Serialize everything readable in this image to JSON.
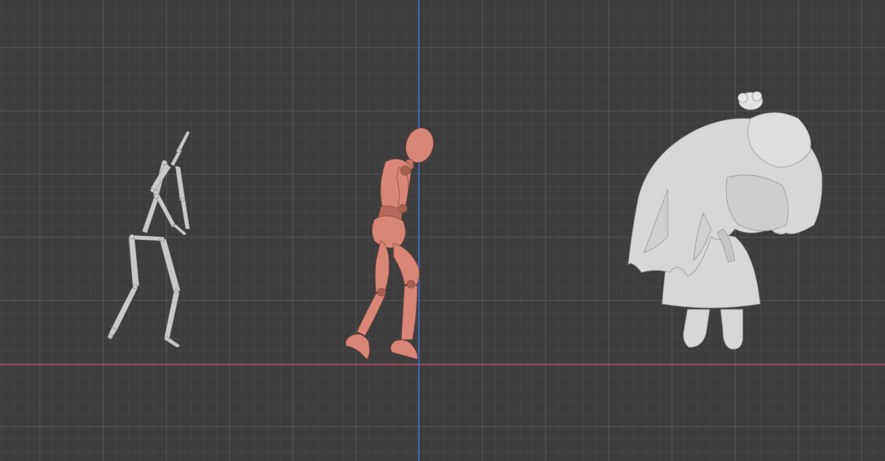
{
  "viewport": {
    "background_color": "#3d3d3d",
    "x_axis_color": "#b5465f",
    "y_axis_color": "#3f6fd6"
  },
  "scene_objects": [
    {
      "name": "armature",
      "color": "#c8c8c8"
    },
    {
      "name": "mannequin",
      "color": "#d98676"
    },
    {
      "name": "character",
      "color": "#d7d7d7"
    }
  ]
}
